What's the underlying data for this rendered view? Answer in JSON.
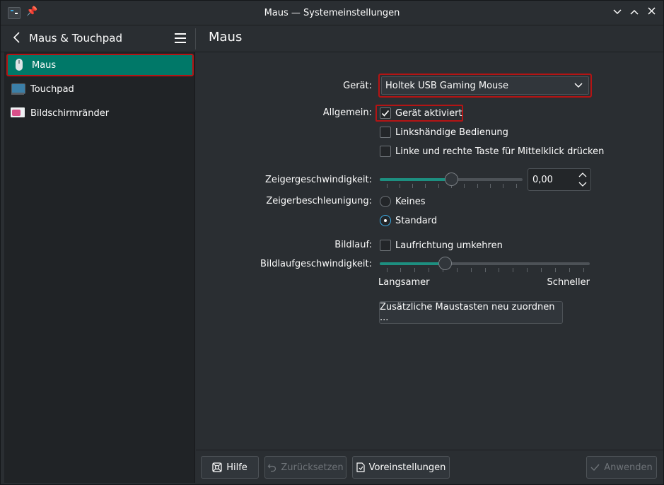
{
  "window": {
    "title": "Maus — Systemeinstellungen",
    "buttons": [
      "minimize",
      "maximize",
      "close"
    ]
  },
  "header": {
    "module_title": "Maus & Touchpad",
    "page_title": "Maus"
  },
  "sidebar": {
    "items": [
      {
        "label": "Maus",
        "icon": "mouse-icon",
        "active": true
      },
      {
        "label": "Touchpad",
        "icon": "touchpad-icon",
        "active": false
      },
      {
        "label": "Bildschirmränder",
        "icon": "screen-edges-icon",
        "active": false
      }
    ]
  },
  "form": {
    "device_label": "Gerät:",
    "device_value": "Holtek USB Gaming Mouse",
    "general_label": "Allgemein:",
    "options": [
      {
        "label": "Gerät aktiviert",
        "checked": true
      },
      {
        "label": "Linkshändige Bedienung",
        "checked": false
      },
      {
        "label": "Linke und rechte Taste für Mittelklick drücken",
        "checked": false
      }
    ],
    "pointer_speed_label": "Zeigergeschwindigkeit:",
    "pointer_speed_value": "0,00",
    "pointer_speed_fraction": 0.5,
    "accel_label": "Zeigerbeschleunigung:",
    "accel_options": [
      {
        "label": "Keines",
        "selected": false
      },
      {
        "label": "Standard",
        "selected": true
      }
    ],
    "scroll_label": "Bildlauf:",
    "scroll_invert_label": "Laufrichtung umkehren",
    "scroll_invert_checked": false,
    "scroll_speed_label": "Bildlaufgeschwindigkeit:",
    "scroll_speed_fraction": 0.3,
    "scroll_slower": "Langsamer",
    "scroll_faster": "Schneller",
    "remap_button": "Zusätzliche Maustasten neu zuordnen ..."
  },
  "footer": {
    "help": "Hilfe",
    "reset": "Zurücksetzen",
    "defaults": "Voreinstellungen",
    "apply": "Anwenden"
  },
  "colors": {
    "accent": "#1d8f80",
    "selection": "#007868",
    "highlight_border": "#b41414",
    "background": "#2a2e32",
    "sidebar": "#202326"
  }
}
